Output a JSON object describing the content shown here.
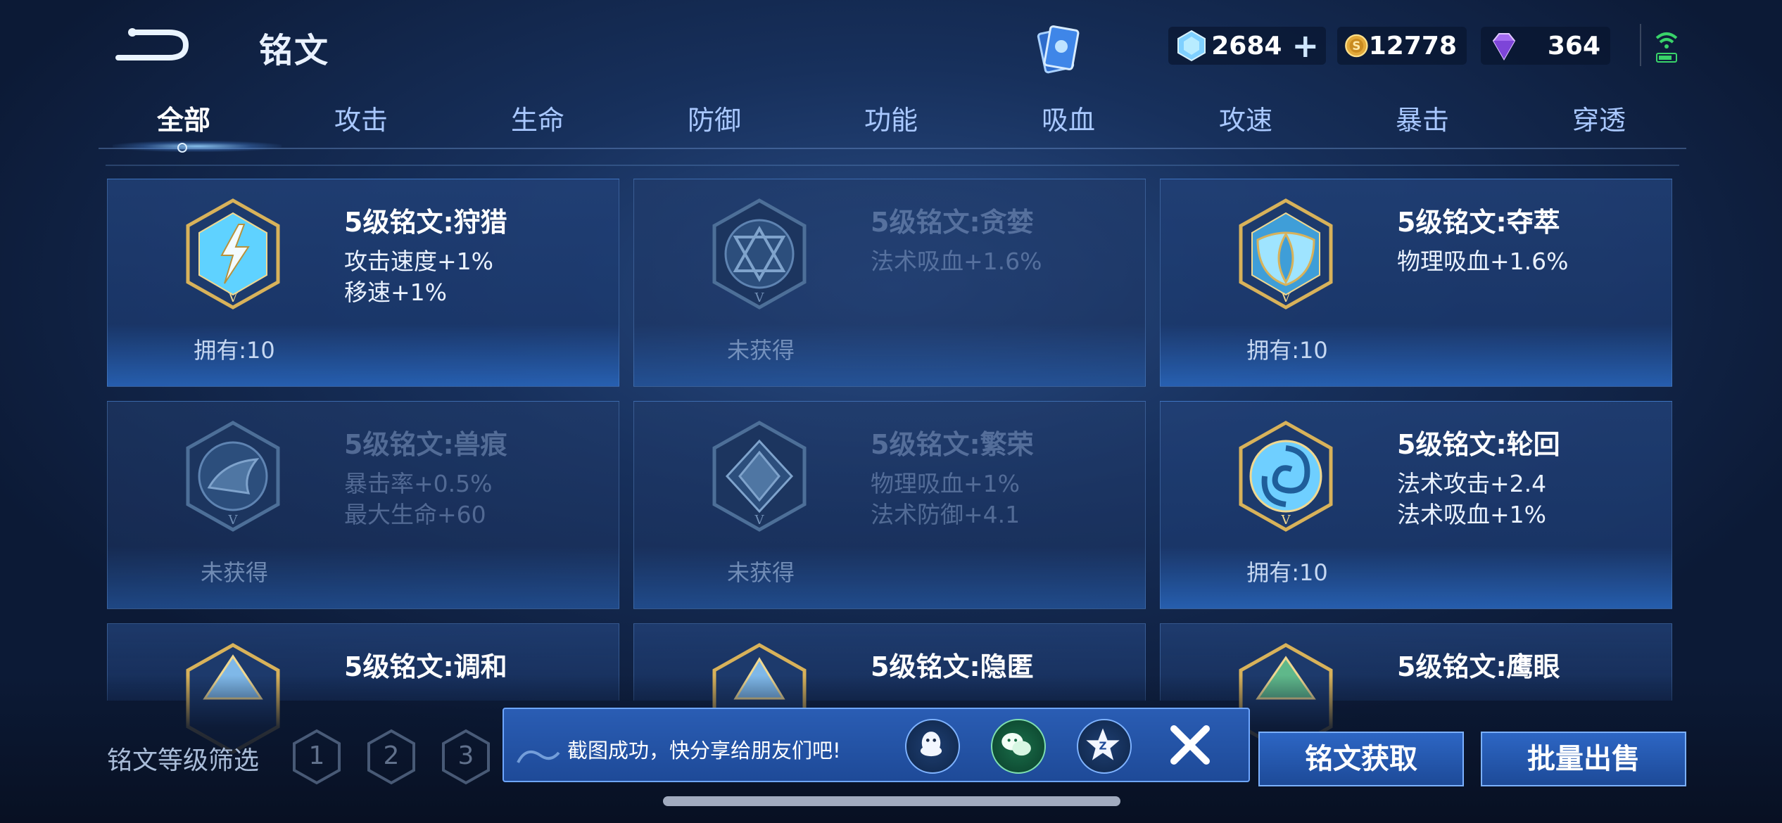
{
  "header": {
    "title": "铭文",
    "currencies": [
      {
        "name": "diamond-currency",
        "value": "2684",
        "icon": "diamond-icon"
      },
      {
        "name": "gold-currency",
        "value": "12778",
        "icon": "gold-coin-icon"
      },
      {
        "name": "gem-currency",
        "value": "364",
        "icon": "purple-gem-icon"
      }
    ],
    "plus_symbol": "+"
  },
  "tabs": [
    {
      "label": "全部",
      "active": true
    },
    {
      "label": "攻击"
    },
    {
      "label": "生命"
    },
    {
      "label": "防御"
    },
    {
      "label": "功能"
    },
    {
      "label": "吸血"
    },
    {
      "label": "攻速"
    },
    {
      "label": "暴击"
    },
    {
      "label": "穿透"
    }
  ],
  "cards": [
    {
      "name": "5级铭文:狩猎",
      "attr1": "攻击速度+1%",
      "attr2": "移速+1%",
      "status": "拥有:10",
      "owned": true,
      "color": "#5fd2ff"
    },
    {
      "name": "5级铭文:贪婪",
      "attr1": "法术吸血+1.6%",
      "attr2": "",
      "status": "未获得",
      "owned": false,
      "color": "#4d7aa8"
    },
    {
      "name": "5级铭文:夺萃",
      "attr1": "物理吸血+1.6%",
      "attr2": "",
      "status": "拥有:10",
      "owned": true,
      "color": "#5fd2ff"
    },
    {
      "name": "5级铭文:兽痕",
      "attr1": "暴击率+0.5%",
      "attr2": "最大生命+60",
      "status": "未获得",
      "owned": false,
      "color": "#4d7aa8"
    },
    {
      "name": "5级铭文:繁荣",
      "attr1": "物理吸血+1%",
      "attr2": "法术防御+4.1",
      "status": "未获得",
      "owned": false,
      "color": "#4d7aa8"
    },
    {
      "name": "5级铭文:轮回",
      "attr1": "法术攻击+2.4",
      "attr2": "法术吸血+1%",
      "status": "拥有:10",
      "owned": true,
      "color": "#5fd2ff"
    },
    {
      "name": "5级铭文:调和",
      "attr1": "",
      "attr2": "",
      "status": "",
      "owned": true,
      "color": "#7fb8e8"
    },
    {
      "name": "5级铭文:隐匿",
      "attr1": "",
      "attr2": "",
      "status": "",
      "owned": true,
      "color": "#7fb8e8"
    },
    {
      "name": "5级铭文:鹰眼",
      "attr1": "",
      "attr2": "",
      "status": "",
      "owned": true,
      "color": "#5fb88a"
    }
  ],
  "filter": {
    "label": "铭文等级筛选",
    "levels": [
      "1",
      "2",
      "3"
    ]
  },
  "toast": {
    "message": "截图成功，快分享给朋友们吧!",
    "share_targets": [
      "qq-icon",
      "wechat-icon",
      "qzone-icon"
    ]
  },
  "buttons": {
    "acquire": "铭文获取",
    "sell": "批量出售"
  },
  "colors": {
    "gold_border": "#d8b25a",
    "accent_blue": "#2d66c4"
  }
}
